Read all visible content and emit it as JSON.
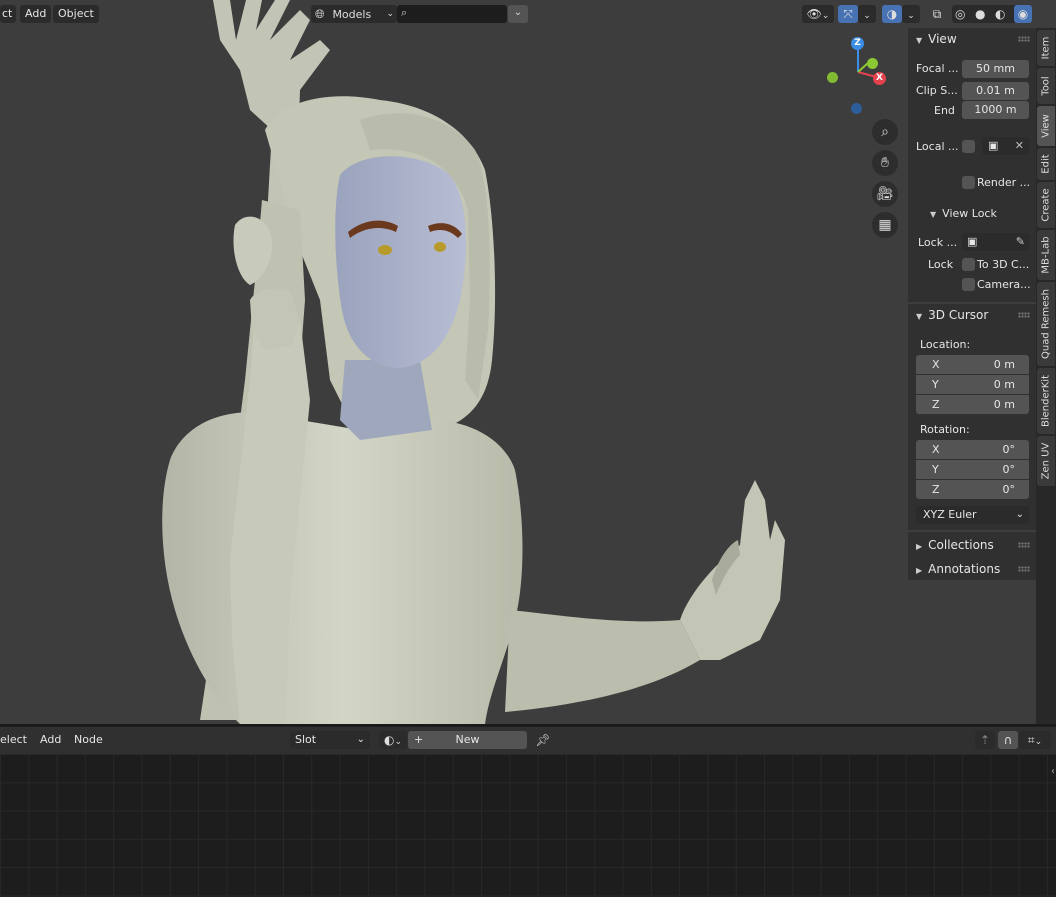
{
  "viewport_header": {
    "menu_select": "ct",
    "menu_add": "Add",
    "menu_object": "Object",
    "collection_select": "Models",
    "search_placeholder": ""
  },
  "npanel": {
    "view": {
      "title": "View",
      "focal_label": "Focal ...",
      "focal_value": "50 mm",
      "clip_start_label": "Clip S...",
      "clip_start_value": "0.01 m",
      "clip_end_label": "End",
      "clip_end_value": "1000 m",
      "local_camera_label": "Local ...",
      "render_region_label": "Render ...",
      "view_lock": {
        "title": "View Lock",
        "lock_object_label": "Lock ...",
        "lock_label": "Lock",
        "to_3d_cursor_label": "To 3D C...",
        "camera_label": "Camera..."
      }
    },
    "cursor": {
      "title": "3D Cursor",
      "location_label": "Location:",
      "location": [
        {
          "axis": "X",
          "value": "0 m"
        },
        {
          "axis": "Y",
          "value": "0 m"
        },
        {
          "axis": "Z",
          "value": "0 m"
        }
      ],
      "rotation_label": "Rotation:",
      "rotation": [
        {
          "axis": "X",
          "value": "0°"
        },
        {
          "axis": "Y",
          "value": "0°"
        },
        {
          "axis": "Z",
          "value": "0°"
        }
      ],
      "rotation_mode": "XYZ Euler"
    },
    "collections_title": "Collections",
    "annotations_title": "Annotations"
  },
  "tabs": [
    "Item",
    "Tool",
    "View",
    "Edit",
    "Create",
    "MB-Lab",
    "Quad Remesh",
    "BlenderKit",
    "Zen UV"
  ],
  "active_tab": "View",
  "gizmo": {
    "z": "Z",
    "x": "X",
    "colors": {
      "x": "#e4424f",
      "y": "#8bc833",
      "z": "#3b8ee6"
    }
  },
  "node_header": {
    "menu_select": "elect",
    "menu_add": "Add",
    "menu_node": "Node",
    "slot_select": "Slot",
    "new_button": "New"
  }
}
